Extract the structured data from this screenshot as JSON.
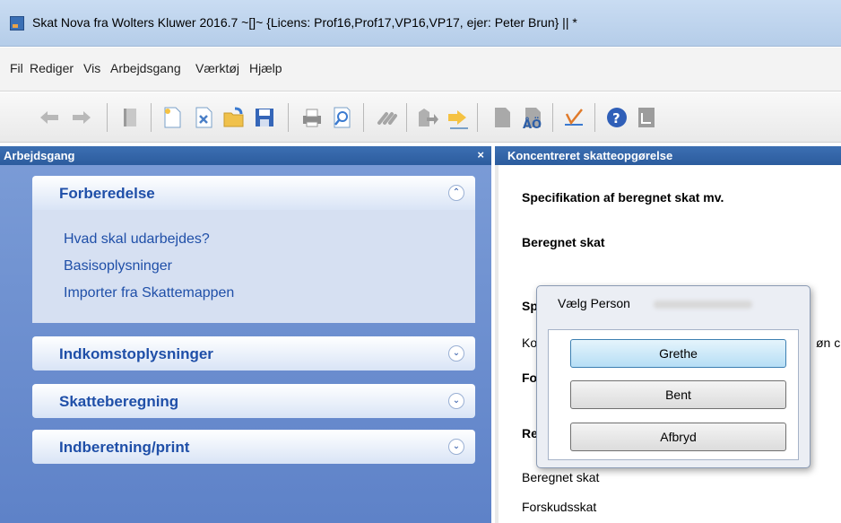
{
  "window": {
    "title": "Skat Nova fra Wolters Kluwer 2016.7  ~[]~   {Licens: Prof16,Prof17,VP16,VP17, ejer: Peter Brun}  || *"
  },
  "menu": [
    "Fil",
    "Rediger",
    "Vis",
    "Arbejdsgang",
    "Værktøj",
    "Hjælp"
  ],
  "toolbar_icons": [
    "back-arrow",
    "forward-arrow",
    "book",
    "new-document",
    "close-document",
    "open-folder",
    "save",
    "print",
    "print-preview",
    "link",
    "person-import",
    "person-export",
    "document",
    "font-ao",
    "checkmark",
    "help",
    "list"
  ],
  "left_panel": {
    "title": "Arbejdsgang",
    "close": "×",
    "sections": [
      {
        "title": "Forberedelse",
        "expanded": true,
        "links": [
          "Hvad skal udarbejdes?",
          "Basisoplysninger",
          "Importer fra Skattemappen"
        ]
      },
      {
        "title": "Indkomstoplysninger",
        "expanded": false
      },
      {
        "title": "Skatteberegning",
        "expanded": false
      },
      {
        "title": "Indberetning/print",
        "expanded": false
      }
    ]
  },
  "right_panel": {
    "title": "Koncentreret skatteopgørelse",
    "heading1": "Specifikation af beregnet skat mv.",
    "heading2": "Beregnet skat",
    "row_spe": "Spe",
    "row_kor": "Kor",
    "row_kor_tail": "øn c",
    "row_for": "For",
    "row_res": "Res",
    "row_beregnet": "Beregnet skat",
    "row_forskud": "Forskudsskat"
  },
  "dialog": {
    "title": "Vælg Person",
    "buttons": [
      "Grethe",
      "Bent",
      "Afbryd"
    ]
  },
  "colors": {
    "panel_header": "#2f62a6",
    "section_title": "#1f4fa8",
    "workflow_bg": "#6a8dcf"
  }
}
